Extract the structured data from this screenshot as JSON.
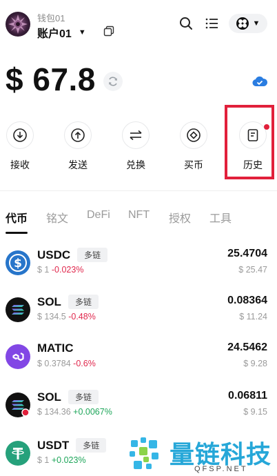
{
  "header": {
    "wallet_name": "钱包01",
    "account_name": "账户01",
    "account_caret": "▼",
    "network_caret": "▼"
  },
  "balance": {
    "display": "$ 67.8"
  },
  "actions": [
    {
      "label": "接收",
      "icon": "receive-icon"
    },
    {
      "label": "发送",
      "icon": "send-icon"
    },
    {
      "label": "兑换",
      "icon": "swap-icon"
    },
    {
      "label": "买币",
      "icon": "buy-icon"
    },
    {
      "label": "历史",
      "icon": "history-icon"
    }
  ],
  "tabs": [
    {
      "label": "代币",
      "active": true
    },
    {
      "label": "铭文",
      "active": false
    },
    {
      "label": "DeFi",
      "active": false
    },
    {
      "label": "NFT",
      "active": false
    },
    {
      "label": "授权",
      "active": false
    },
    {
      "label": "工具",
      "active": false
    }
  ],
  "tokens": [
    {
      "name": "USDC",
      "badge": "多链",
      "price": "$ 1",
      "change": "-0.023%",
      "change_dir": "neg",
      "amount": "25.4704",
      "value": "$ 25.47",
      "icon": "usdc-icon",
      "color": "#2775ca"
    },
    {
      "name": "SOL",
      "badge": "多链",
      "price": "$ 134.5",
      "change": "-0.48%",
      "change_dir": "neg",
      "amount": "0.08364",
      "value": "$ 11.24",
      "icon": "sol-icon",
      "color": "#111111"
    },
    {
      "name": "MATIC",
      "badge": "",
      "price": "$ 0.3784",
      "change": "-0.6%",
      "change_dir": "neg",
      "amount": "24.5462",
      "value": "$ 9.28",
      "icon": "matic-icon",
      "color": "#8247e5"
    },
    {
      "name": "SOL",
      "badge": "多链",
      "price": "$ 134.36",
      "change": "+0.0067%",
      "change_dir": "pos",
      "amount": "0.06811",
      "value": "$ 9.15",
      "icon": "sol-icon",
      "color": "#111111"
    },
    {
      "name": "USDT",
      "badge": "多链",
      "price": "$ 1",
      "change": "+0.023%",
      "change_dir": "pos",
      "amount": "",
      "value": "",
      "icon": "usdt-icon",
      "color": "#26a17b"
    }
  ],
  "watermark": {
    "text": "量链科技",
    "sub": "QFSP.NET"
  },
  "colors": {
    "negative": "#e0284d",
    "positive": "#1ea65a",
    "highlight": "#e1203b"
  }
}
